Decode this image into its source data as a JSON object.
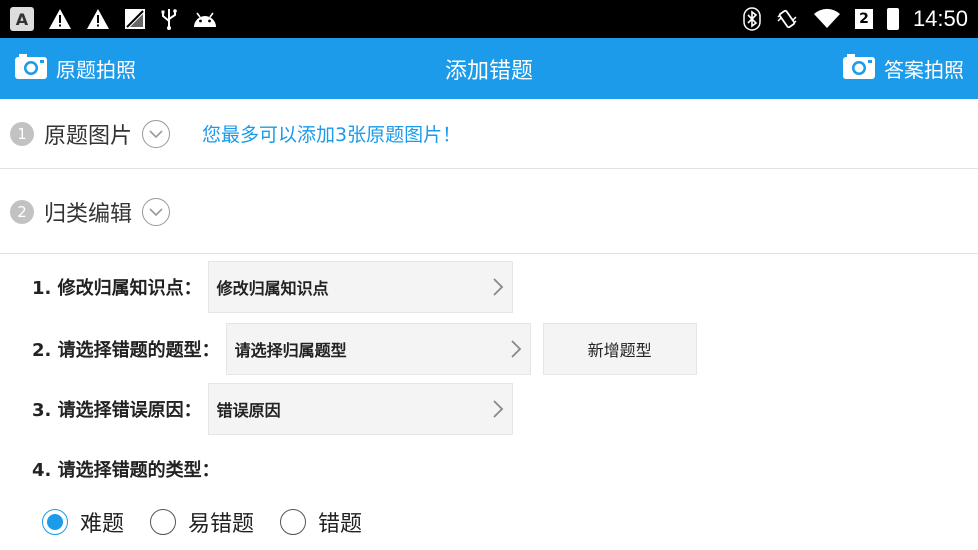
{
  "status_bar": {
    "a_label": "A",
    "sim_label": "2",
    "time": "14:50"
  },
  "header": {
    "left_label": "原题拍照",
    "title": "添加错题",
    "right_label": "答案拍照"
  },
  "section1": {
    "num": "1",
    "title": "原题图片",
    "hint": "您最多可以添加3张原题图片！"
  },
  "section2": {
    "num": "2",
    "title": "归类编辑"
  },
  "form": {
    "row1": {
      "label": "1. 修改归属知识点：",
      "value": "修改归属知识点"
    },
    "row2": {
      "label": "2. 请选择错题的题型：",
      "value": "请选择归属题型",
      "add_button": "新增题型"
    },
    "row3": {
      "label": "3. 请选择错误原因：",
      "value": "错误原因"
    },
    "row4": {
      "label": "4. 请选择错题的类型："
    }
  },
  "radios": [
    {
      "label": "难题",
      "checked": true
    },
    {
      "label": "易错题",
      "checked": false
    },
    {
      "label": "错题",
      "checked": false
    }
  ],
  "colors": {
    "accent": "#1b9bea",
    "status_bar": "#000000"
  }
}
